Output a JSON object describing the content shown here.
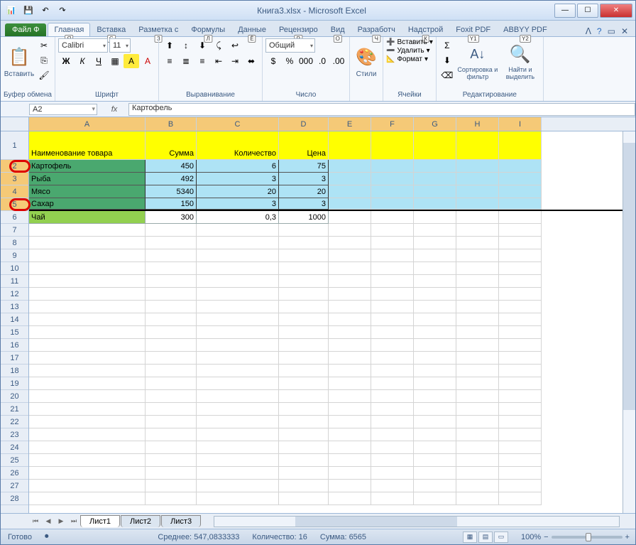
{
  "window": {
    "title": "Книга3.xlsx - Microsoft Excel",
    "qat": [
      "1",
      "2",
      "3",
      "4"
    ]
  },
  "file_tab": "Файл",
  "file_keytip": "Ф",
  "tabs": [
    {
      "label": "Главная",
      "key": "Я",
      "active": true
    },
    {
      "label": "Вставка",
      "key": "С"
    },
    {
      "label": "Разметка с",
      "key": "З"
    },
    {
      "label": "Формулы",
      "key": "Л"
    },
    {
      "label": "Данные",
      "key": "Ё"
    },
    {
      "label": "Рецензиро",
      "key": "Р"
    },
    {
      "label": "Вид",
      "key": "О"
    },
    {
      "label": "Разработч",
      "key": "Ч"
    },
    {
      "label": "Надстрой",
      "key": "К"
    },
    {
      "label": "Foxit PDF",
      "key": "Y1"
    },
    {
      "label": "ABBYY PDF",
      "key": "Y2"
    }
  ],
  "ribbon": {
    "clipboard": {
      "label": "Буфер обмена",
      "paste": "Вставить"
    },
    "font": {
      "label": "Шрифт",
      "name": "Calibri",
      "size": "11",
      "buttons": [
        "Ж",
        "К",
        "Ч"
      ]
    },
    "align": {
      "label": "Выравнивание"
    },
    "number": {
      "label": "Число",
      "format": "Общий"
    },
    "styles": {
      "label": "",
      "btn": "Стили"
    },
    "cells": {
      "label": "Ячейки",
      "insert": "Вставить",
      "delete": "Удалить",
      "format": "Формат"
    },
    "editing": {
      "label": "Редактирование",
      "sort": "Сортировка и фильтр",
      "find": "Найти и выделить"
    }
  },
  "name_box": "A2",
  "formula": "Картофель",
  "columns": [
    "A",
    "B",
    "C",
    "D",
    "E",
    "F",
    "G",
    "H",
    "I"
  ],
  "selected_cols": [
    "A",
    "B",
    "C",
    "D",
    "E",
    "F",
    "G",
    "H",
    "I"
  ],
  "header_row": [
    "Наименование товара",
    "Сумма",
    "Количество",
    "Цена"
  ],
  "data": [
    {
      "n": 2,
      "a": "Картофель",
      "b": "450",
      "c": "6",
      "d": "75",
      "sel": true
    },
    {
      "n": 3,
      "a": "Рыба",
      "b": "492",
      "c": "3",
      "d": "3",
      "sel": true
    },
    {
      "n": 4,
      "a": "Мясо",
      "b": "5340",
      "c": "20",
      "d": "20",
      "sel": true
    },
    {
      "n": 5,
      "a": "Сахар",
      "b": "150",
      "c": "3",
      "d": "3",
      "sel": true
    },
    {
      "n": 6,
      "a": "Чай",
      "b": "300",
      "c": "0,3",
      "d": "1000",
      "sel": false
    }
  ],
  "empty_rows": [
    7,
    8,
    9,
    10,
    11,
    12,
    13,
    14,
    15,
    16,
    17,
    18,
    19,
    20,
    21,
    22,
    23,
    24,
    25,
    26,
    27,
    28
  ],
  "sheets": [
    "Лист1",
    "Лист2",
    "Лист3"
  ],
  "status": {
    "ready": "Готово",
    "avg_label": "Среднее:",
    "avg": "547,0833333",
    "count_label": "Количество:",
    "count": "16",
    "sum_label": "Сумма:",
    "sum": "6565",
    "zoom": "100%"
  }
}
